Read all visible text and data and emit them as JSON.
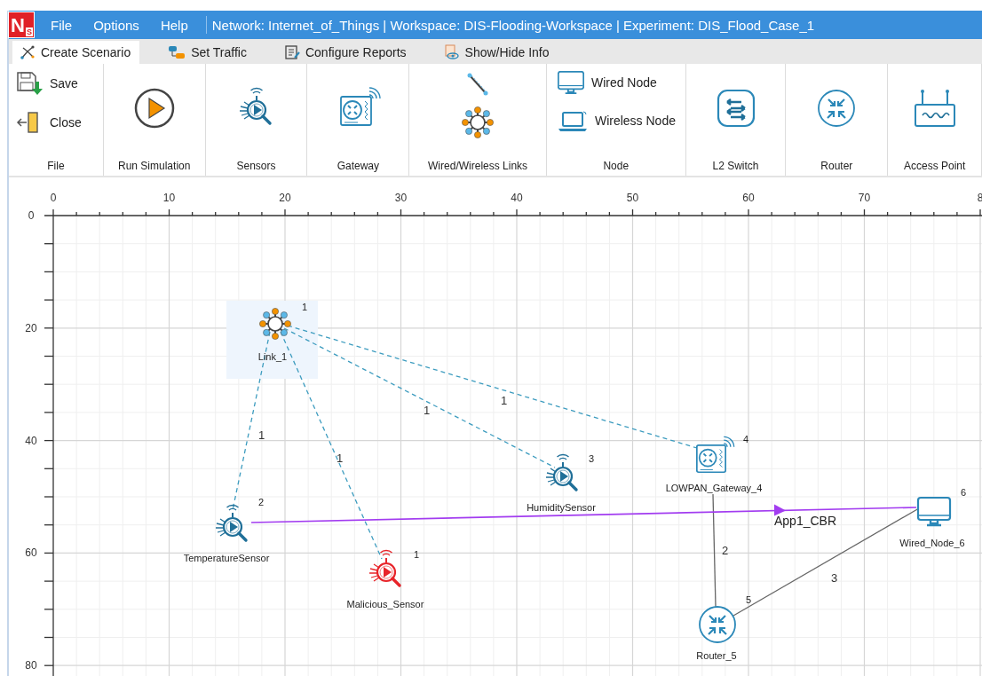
{
  "title_bar": {
    "logo": {
      "mark": "N",
      "sub": "S"
    },
    "menu": [
      "File",
      "Options",
      "Help"
    ],
    "title": "Network: Internet_of_Things | Workspace: DIS-Flooding-Workspace | Experiment: DIS_Flood_Case_1"
  },
  "tabs": [
    {
      "label": "Create Scenario",
      "selected": true
    },
    {
      "label": "Set Traffic",
      "selected": false
    },
    {
      "label": "Configure Reports",
      "selected": false
    },
    {
      "label": "Show/Hide Info",
      "selected": false
    }
  ],
  "ribbon": [
    {
      "label": "File",
      "kind": "small",
      "buttons": [
        "Save",
        "Close"
      ]
    },
    {
      "label": "Run Simulation",
      "kind": "large"
    },
    {
      "label": "Sensors",
      "kind": "large"
    },
    {
      "label": "Gateway",
      "kind": "large"
    },
    {
      "label": "Wired/Wireless Links",
      "kind": "stack"
    },
    {
      "label": "Node",
      "kind": "small",
      "buttons": [
        "Wired Node",
        "Wireless Node"
      ]
    },
    {
      "label": "L2 Switch",
      "kind": "large"
    },
    {
      "label": "Router",
      "kind": "large"
    },
    {
      "label": "Access Point",
      "kind": "large"
    }
  ],
  "canvas": {
    "x_ruler": [
      "0",
      "10",
      "20",
      "30",
      "40",
      "50",
      "60",
      "70",
      "8"
    ],
    "y_ruler": [
      "0",
      "20",
      "40",
      "60",
      "80"
    ],
    "nodes": [
      {
        "kind": "link",
        "name": "Link_1",
        "number": "1",
        "selected": true
      },
      {
        "kind": "sensor",
        "name": "TemperatureSensor",
        "number": "2",
        "selected": false
      },
      {
        "kind": "malicious_sensor",
        "name": "Malicious_Sensor",
        "number": "1",
        "selected": false
      },
      {
        "kind": "sensor",
        "name": "HumiditySensor",
        "number": "3",
        "selected": false
      },
      {
        "kind": "gateway",
        "name": "LOWPAN_Gateway_4",
        "number": "4",
        "selected": false
      },
      {
        "kind": "wired_node",
        "name": "Wired_Node_6",
        "number": "6",
        "selected": false
      },
      {
        "kind": "router",
        "name": "Router_5",
        "number": "5",
        "selected": false
      }
    ],
    "links": [
      {
        "kind": "wireless",
        "label": "1"
      },
      {
        "kind": "wireless",
        "label": "1"
      },
      {
        "kind": "wireless",
        "label": "1"
      },
      {
        "kind": "wireless",
        "label": "1"
      },
      {
        "kind": "wired",
        "label": "2"
      },
      {
        "kind": "wired",
        "label": "3"
      }
    ],
    "applications": [
      {
        "label": "App1_CBR"
      }
    ]
  }
}
